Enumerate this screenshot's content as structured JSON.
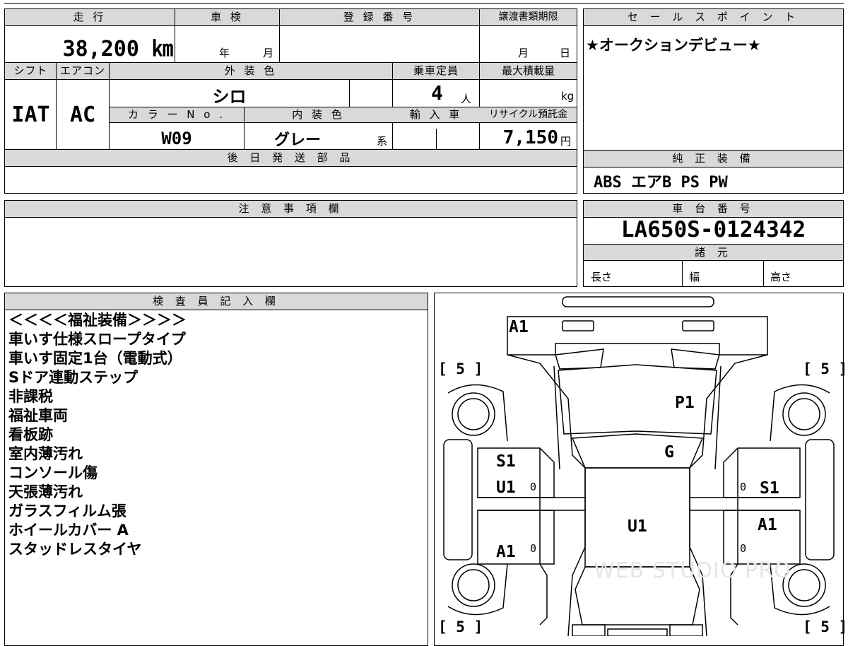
{
  "vehicle": {
    "labels": {
      "mileage": "走 行",
      "inspection": "車 検",
      "registration_no": "登 録 番 号",
      "transfer_deadline": "譲渡書類期限",
      "shift": "シフト",
      "aircon": "エアコン",
      "exterior_color": "外 装 色",
      "capacity": "乗車定員",
      "max_load": "最大積載量",
      "color_no": "カ ラ ー N o .",
      "interior_color": "内 装 色",
      "import": "輸 入 車",
      "recycle_fee": "リサイクル預託金",
      "later_parts": "後 日 発 送 部 品"
    },
    "mileage": "38,200 ㎞",
    "inspection_year": "年",
    "inspection_month": "月",
    "transfer_month": "月",
    "transfer_day": "日",
    "shift": "IAT",
    "aircon": "AC",
    "exterior_color": "シロ",
    "capacity": "4",
    "capacity_unit": "人",
    "max_load_unit": "kg",
    "color_no": "W09",
    "interior_color": "グレー",
    "interior_suffix": "系",
    "recycle_fee": "7,150",
    "recycle_unit": "円"
  },
  "sales_point": {
    "label": "セ ー ル ス ポ イ ン ト",
    "text": "★オークションデビュー★"
  },
  "equipment": {
    "label": "純 正 装 備",
    "text": "ABS エアB PS PW"
  },
  "caution": {
    "label": "注 意 事 項 欄"
  },
  "chassis": {
    "label": "車 台 番 号",
    "number": "LA650S-0124342",
    "specs_label": "諸 元",
    "length": "長さ",
    "width": "幅",
    "height": "高さ"
  },
  "inspector": {
    "label": "検 査 員 記 入 欄",
    "lines": [
      "＜＜＜＜福祉装備＞＞＞＞",
      "車いす仕様スロープタイプ",
      "車いす固定1台（電動式）",
      "Sドア連動ステップ",
      "非課税",
      "福祉車両",
      "看板跡",
      "室内薄汚れ",
      "コンソール傷",
      "天張薄汚れ",
      "ガラスフィルム張",
      "ホイールカバー A",
      "スタッドレスタイヤ"
    ]
  },
  "diagram": {
    "tire_tl": "[ 5 ]",
    "tire_tr": "[ 5 ]",
    "tire_bl": "[ 5 ]",
    "tire_br": "[ 5 ]",
    "marks": {
      "front_bumper": "A1",
      "bonnet": "P1",
      "windshield": "G",
      "left_front_door": "S1",
      "left_front_door_2": "U1",
      "left_rear_door": "A1",
      "right_front_door": "S1",
      "right_rear_door": "A1",
      "roof": "U1",
      "zero": "0"
    },
    "watermark": "WEB STUDIO PRO"
  }
}
